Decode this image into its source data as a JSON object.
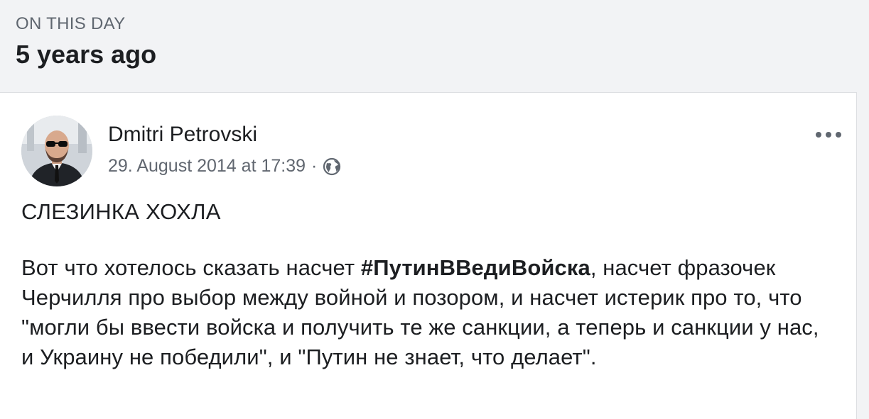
{
  "memories": {
    "section_label": "ON THIS DAY",
    "title": "5 years ago"
  },
  "post": {
    "author": "Dmitri Petrovski",
    "timestamp": "29. August 2014 at 17:39",
    "separator": "·",
    "privacy_icon": "globe-icon",
    "menu_icon": "more-icon",
    "heading": "СЛЕЗИНКА ХОХЛА",
    "body_before_tag": "Вот что хотелось сказать насчет ",
    "hashtag": "#ПутинВВедиВойска",
    "body_after_tag": ", насчет фразочек Черчилля про выбор между войной и позором, и насчет истерик про то, что \"могли бы ввести войска и получить те же санкции, а теперь и санкции у нас, и Украину не победили\", и \"Путин не знает, что делает\"."
  }
}
